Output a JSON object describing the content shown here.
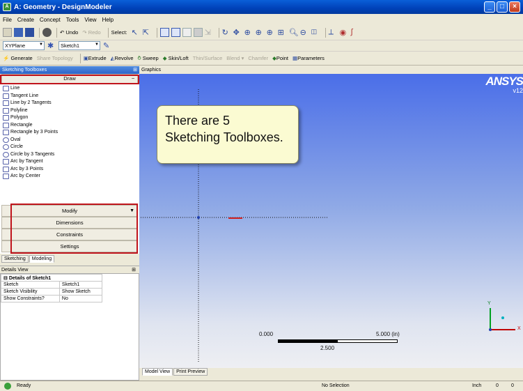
{
  "window": {
    "title": "A: Geometry - DesignModeler"
  },
  "menubar": [
    "File",
    "Create",
    "Concept",
    "Tools",
    "View",
    "Help"
  ],
  "toolbar1": {
    "undo_label": "Undo",
    "redo_label": "Redo",
    "select_label": "Select:"
  },
  "toolbar2": {
    "plane_value": "XYPlane",
    "sketch_value": "Sketch1"
  },
  "toolbar3": {
    "generate": "Generate",
    "share_topology": "Share Topology",
    "extrude": "Extrude",
    "revolve": "Revolve",
    "sweep": "Sweep",
    "skin_loft": "Skin/Loft",
    "thin_surface": "Thin/Surface",
    "blend": "Blend",
    "chamfer": "Chamfer",
    "point": "Point",
    "parameters": "Parameters"
  },
  "left_panel": {
    "header": "Sketching Toolboxes",
    "draw_label": "Draw",
    "draw_items": [
      "Line",
      "Tangent Line",
      "Line by 2 Tangents",
      "Polyline",
      "Polygon",
      "Rectangle",
      "Rectangle by 3 Points",
      "Oval",
      "Circle",
      "Circle by 3 Tangents",
      "Arc by Tangent",
      "Arc by 3 Points",
      "Arc by Center"
    ],
    "toolboxes": [
      "Modify",
      "Dimensions",
      "Constraints",
      "Settings"
    ],
    "tabs": [
      "Sketching",
      "Modeling"
    ]
  },
  "details": {
    "header": "Details View",
    "group": "Details of Sketch1",
    "rows": [
      {
        "label": "Sketch",
        "value": "Sketch1"
      },
      {
        "label": "Sketch Visibility",
        "value": "Show Sketch"
      },
      {
        "label": "Show Constraints?",
        "value": "No"
      }
    ]
  },
  "graphics": {
    "header": "Graphics",
    "logo": "ANSYS",
    "version": "v12",
    "callout_line1": "There are 5",
    "callout_line2": "Sketching Toolboxes.",
    "scale_start": "0.000",
    "scale_end": "5.000 (in)",
    "scale_mid": "2.500",
    "axis_x": "X",
    "axis_y": "Y",
    "tabs": [
      "Model View",
      "Print Preview"
    ]
  },
  "statusbar": {
    "ready": "Ready",
    "selection": "No Selection",
    "units": "Inch",
    "val1": "0",
    "val2": "0"
  },
  "colors": {
    "highlight": "#c0141c",
    "title_bar": "#0a5fd8"
  }
}
